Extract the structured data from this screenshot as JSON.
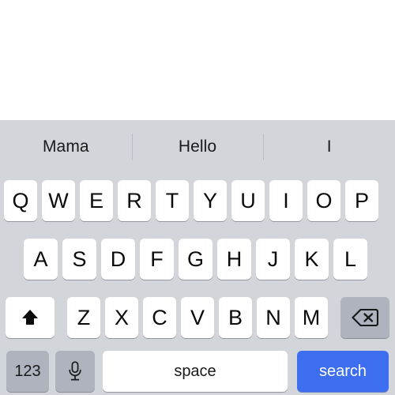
{
  "screen": {
    "background_color": "#ffffff",
    "keyboard_background_color": "#d2d5da"
  },
  "content_area": {
    "text": ""
  },
  "suggestion_bar": {
    "items": [
      {
        "label": "Mama"
      },
      {
        "label": "Hello"
      },
      {
        "label": "I"
      }
    ]
  },
  "keyboard": {
    "type": "ios-qwerty-uppercase",
    "rows": {
      "row1": [
        {
          "label": "Q"
        },
        {
          "label": "W"
        },
        {
          "label": "E"
        },
        {
          "label": "R"
        },
        {
          "label": "T"
        },
        {
          "label": "Y"
        },
        {
          "label": "U"
        },
        {
          "label": "I"
        },
        {
          "label": "O"
        },
        {
          "label": "P"
        }
      ],
      "row2": [
        {
          "label": "A"
        },
        {
          "label": "S"
        },
        {
          "label": "D"
        },
        {
          "label": "F"
        },
        {
          "label": "G"
        },
        {
          "label": "H"
        },
        {
          "label": "J"
        },
        {
          "label": "K"
        },
        {
          "label": "L"
        }
      ],
      "row3": [
        {
          "label": "Z"
        },
        {
          "label": "X"
        },
        {
          "label": "C"
        },
        {
          "label": "V"
        },
        {
          "label": "B"
        },
        {
          "label": "N"
        },
        {
          "label": "M"
        }
      ]
    },
    "shift_key": {
      "icon": "shift-arrow-up-icon",
      "label": "",
      "state": "uppercase",
      "color": "#ffffff"
    },
    "backspace_key": {
      "icon": "backspace-delete-icon",
      "label": "",
      "color": "#aeb3bd"
    },
    "numeric_key": {
      "label": "123",
      "color": "#aeb3bd"
    },
    "dictation_key": {
      "icon": "microphone-icon",
      "label": "",
      "color": "#aeb3bd"
    },
    "space_key": {
      "label": "space",
      "color": "#ffffff"
    },
    "return_key": {
      "label": "search",
      "color": "#3d6ef0",
      "text_color": "#ffffff"
    }
  }
}
